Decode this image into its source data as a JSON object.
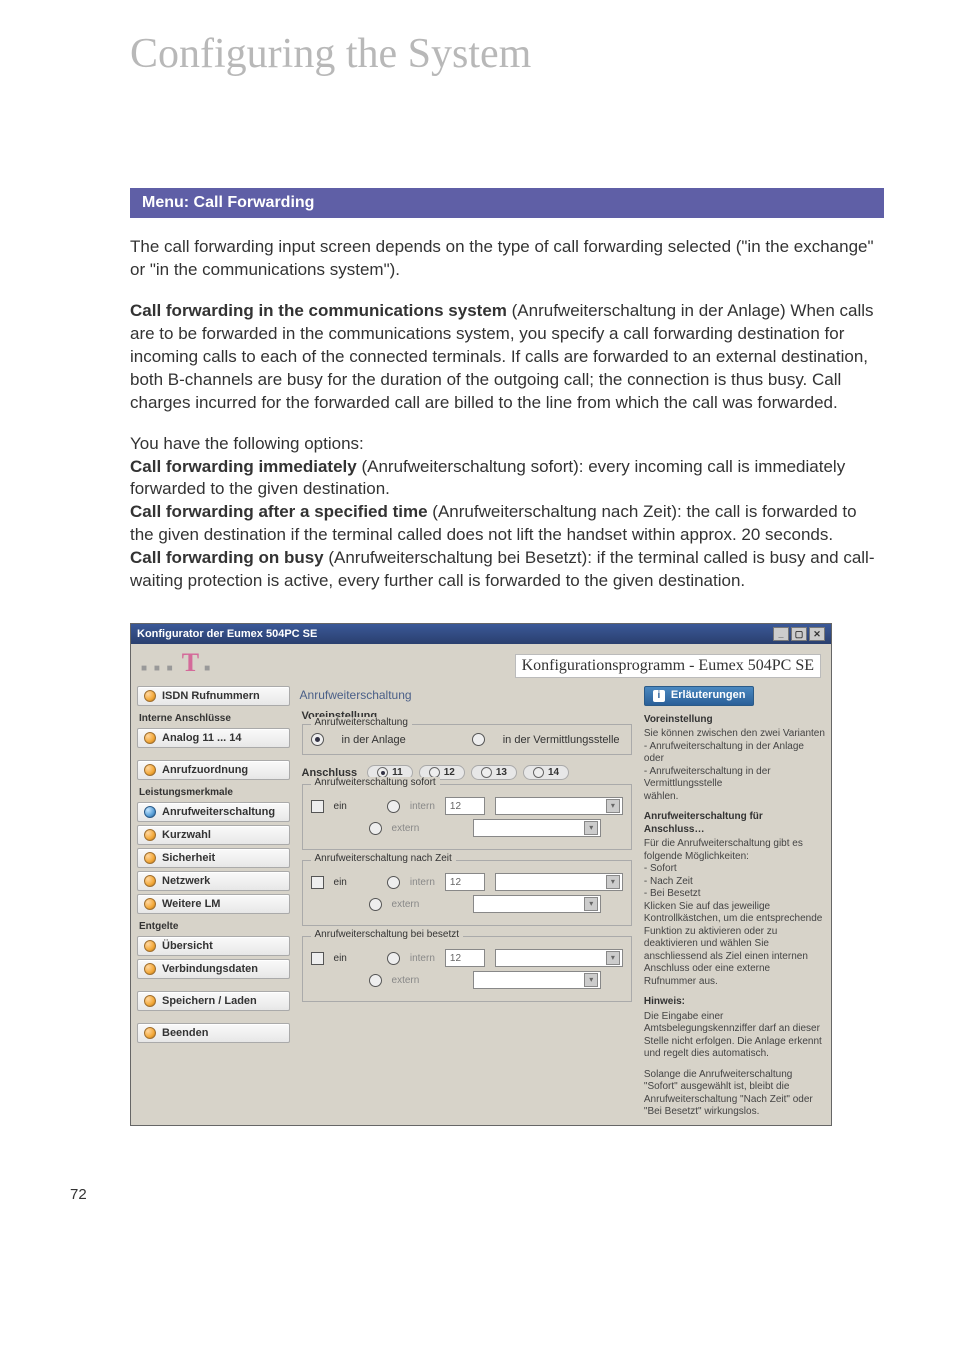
{
  "chapterTitle": "Configuring the System",
  "sectionBar": "Menu: Call Forwarding",
  "paragraphs": {
    "intro": "The call forwarding input screen depends on the type of call forwarding selected (\"in the exchange\" or \"in the communications system\").",
    "cfcs_head": "Call forwarding in the communications system",
    "cfcs_tail": " (Anrufweiterschaltung in der Anlage) When calls are to be forwarded in the communications system, you specify a call forwarding destination for incoming calls to each of the connected terminals.\nIf calls are forwarded to an external destination, both B-channels are busy for the duration of the outgoing call; the connection is thus busy. Call charges incurred for the forwarded call are billed to the line from which the call was forwarded.",
    "options_lead": "You have the following options:",
    "cfi_head": "Call forwarding immediately",
    "cfi_tail": " (Anrufweiterschaltung sofort): every incoming call is immediately forwarded to the given destination.",
    "cft_head": "Call forwarding after a specified time",
    "cft_tail": " (Anrufweiterschaltung nach Zeit): the call is forwarded to the given destination if the terminal called does not lift the handset within approx. 20 seconds.",
    "cfb_head": "Call forwarding on busy",
    "cfb_tail": " (Anrufweiterschaltung bei Besetzt): if the terminal called is busy and call-waiting protection is active, every further call is forwarded to the given destination."
  },
  "screenshot": {
    "windowTitle": "Konfigurator der Eumex 504PC SE",
    "logo": "T",
    "appTitle": "Konfigurationsprogramm - Eumex 504PC SE",
    "centerTitle": "Anrufweiterschaltung",
    "sidebar": {
      "items": [
        {
          "label": "ISDN Rufnummern"
        },
        {
          "label": "Analog 11 ... 14"
        },
        {
          "label": "Anrufzuordnung"
        },
        {
          "label": "Anrufweiterschaltung",
          "selected": true
        },
        {
          "label": "Kurzwahl"
        },
        {
          "label": "Sicherheit"
        },
        {
          "label": "Netzwerk"
        },
        {
          "label": "Weitere LM"
        },
        {
          "label": "Übersicht"
        },
        {
          "label": "Verbindungsdaten"
        },
        {
          "label": "Speichern / Laden"
        },
        {
          "label": "Beenden"
        }
      ],
      "headings": {
        "interne": "Interne Anschlüsse",
        "leistung": "Leistungsmerkmale",
        "entgelte": "Entgelte"
      }
    },
    "presetBox": {
      "title": "Voreinstellung",
      "sub": "Anrufweiterschaltung",
      "opt1": "in der Anlage",
      "opt2": "in der Vermittlungsstelle"
    },
    "tabs": {
      "label": "Anschluss",
      "items": [
        "11",
        "12",
        "13",
        "14"
      ]
    },
    "groups": {
      "sofort": {
        "title": "Anrufweiterschaltung sofort",
        "ein": "ein",
        "intern": "intern",
        "extern": "extern",
        "internVal": "12"
      },
      "zeit": {
        "title": "Anrufweiterschaltung nach Zeit",
        "ein": "ein",
        "intern": "intern",
        "extern": "extern",
        "internVal": "12"
      },
      "besetzt": {
        "title": "Anrufweiterschaltung bei besetzt",
        "ein": "ein",
        "intern": "intern",
        "extern": "extern",
        "internVal": "12"
      }
    },
    "rightcol": {
      "btn": "Erläuterungen",
      "h1": "Voreinstellung",
      "p1": "Sie können zwischen den zwei Varianten\n- Anrufweiterschaltung in der Anlage oder\n- Anrufweiterschaltung in der Vermittlungsstelle\nwählen.",
      "h2": "Anrufweiterschaltung für Anschluss…",
      "p2": "Für die Anrufweiterschaltung gibt es folgende Möglichkeiten:\n- Sofort\n- Nach Zeit\n- Bei Besetzt\nKlicken Sie auf das jeweilige Kontrollkästchen, um die entsprechende Funktion zu aktivieren oder zu deaktivieren und wählen Sie anschliessend als Ziel einen internen Anschluss oder eine externe Rufnummer aus.",
      "h3": "Hinweis:",
      "p3": "Die Eingabe einer Amtsbelegungskennziffer darf an dieser Stelle nicht erfolgen. Die Anlage erkennt und regelt dies automatisch.",
      "p4": "Solange die Anrufweiterschaltung \"Sofort\" ausgewählt ist, bleibt die Anrufweiterschaltung \"Nach Zeit\" oder \"Bei Besetzt\" wirkungslos."
    }
  },
  "pageNumber": "72"
}
